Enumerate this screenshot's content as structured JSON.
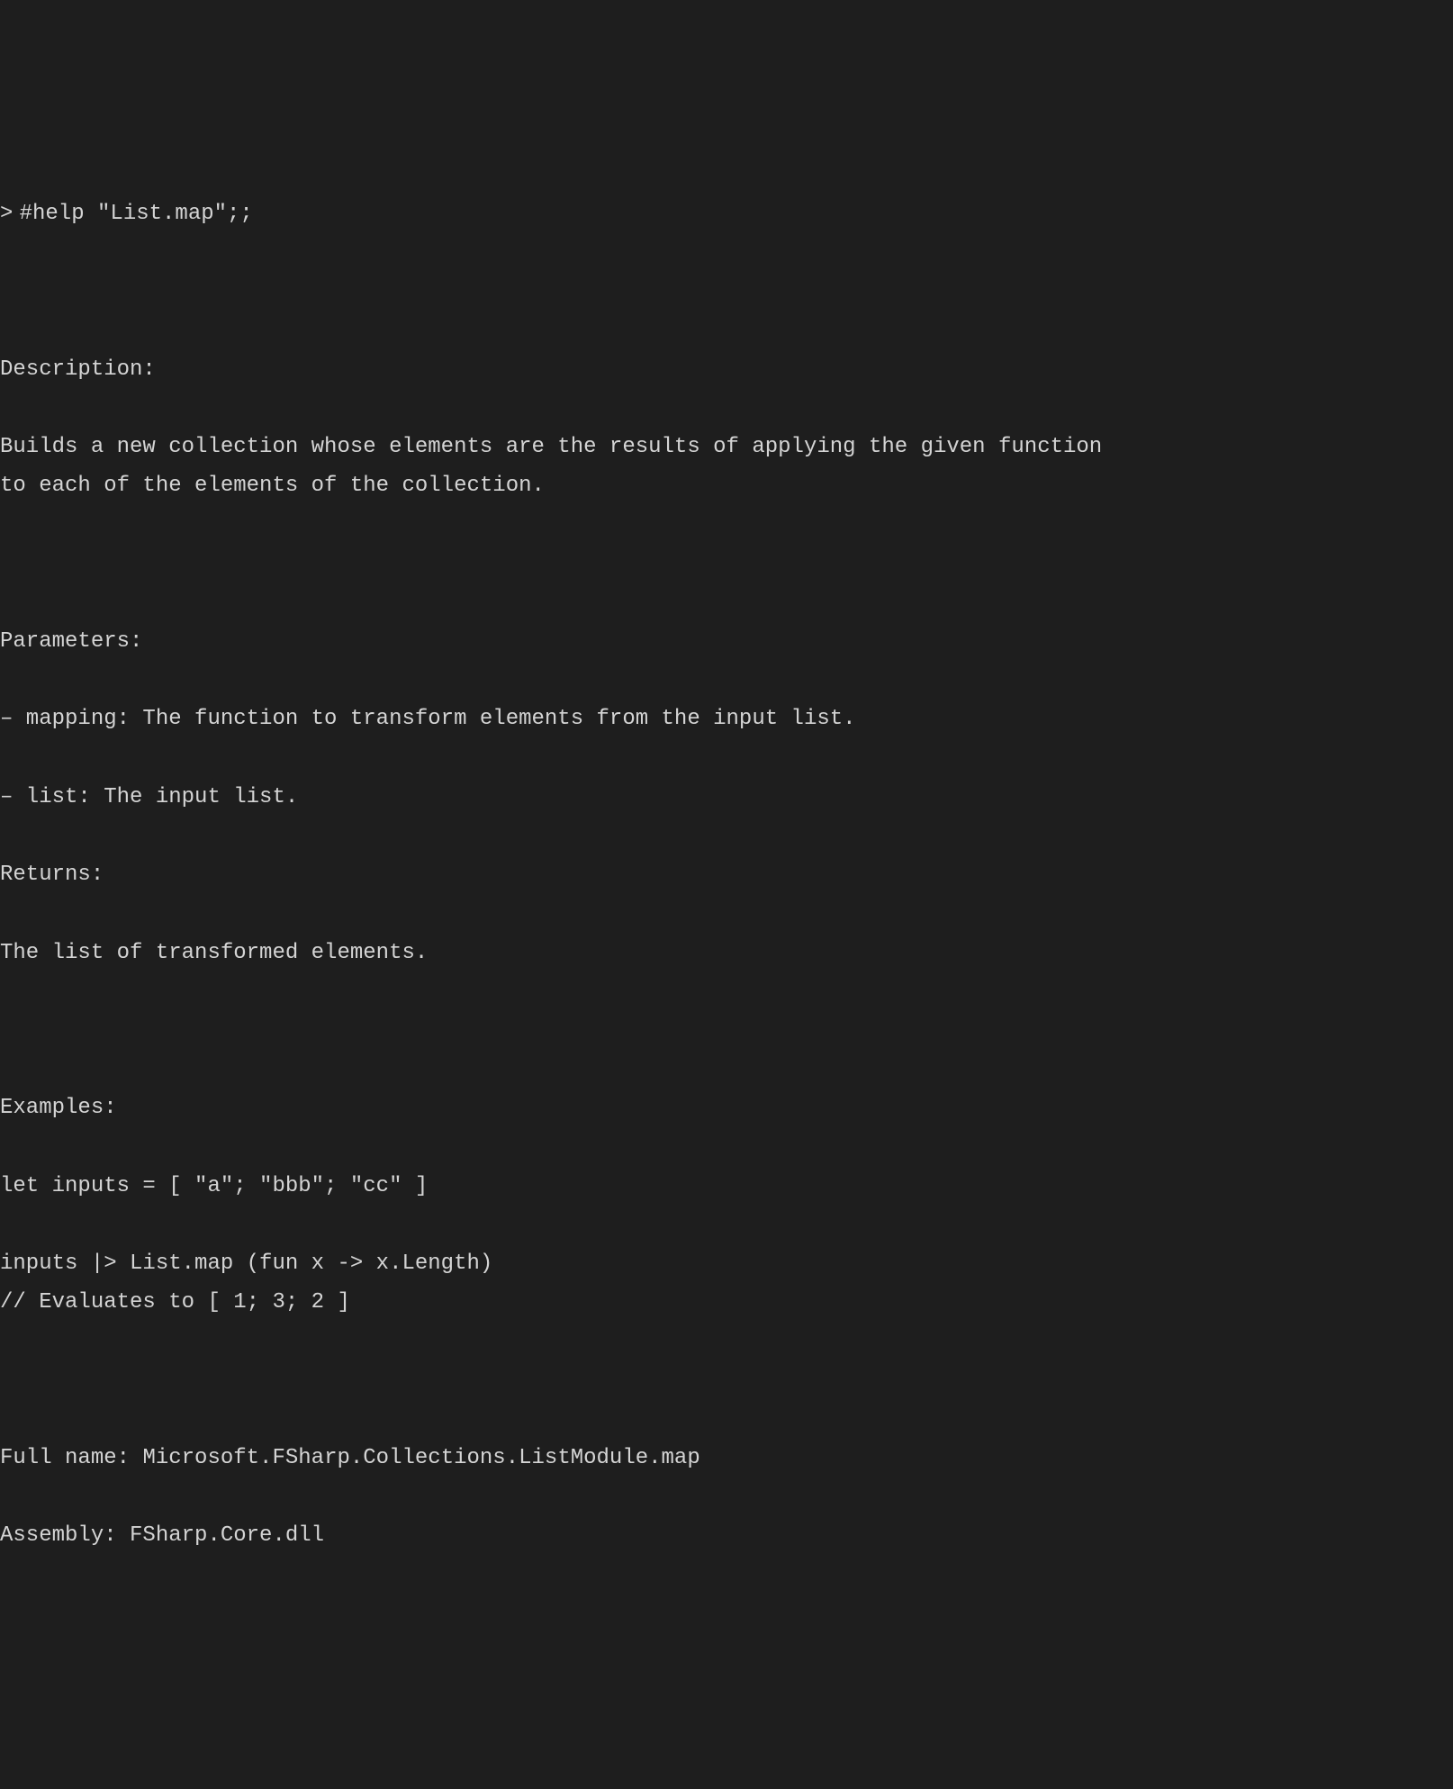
{
  "prompt": {
    "symbol": ">",
    "command": "#help \"List.map\";;"
  },
  "sections": {
    "description": {
      "heading": "Description:",
      "text": "Builds a new collection whose elements are the results of applying the given function\nto each of the elements of the collection."
    },
    "parameters": {
      "heading": "Parameters:",
      "items": [
        "– mapping: The function to transform elements from the input list.",
        "– list: The input list."
      ]
    },
    "returns": {
      "heading": "Returns:",
      "text": "The list of transformed elements."
    },
    "examples": {
      "heading": "Examples:",
      "code": "let inputs = [ \"a\"; \"bbb\"; \"cc\" ]\n\ninputs |> List.map (fun x -> x.Length)\n// Evaluates to [ 1; 3; 2 ]"
    },
    "fullname": {
      "label": "Full name:",
      "value": "Microsoft.FSharp.Collections.ListModule.map"
    },
    "assembly": {
      "label": "Assembly:",
      "value": "FSharp.Core.dll"
    }
  }
}
